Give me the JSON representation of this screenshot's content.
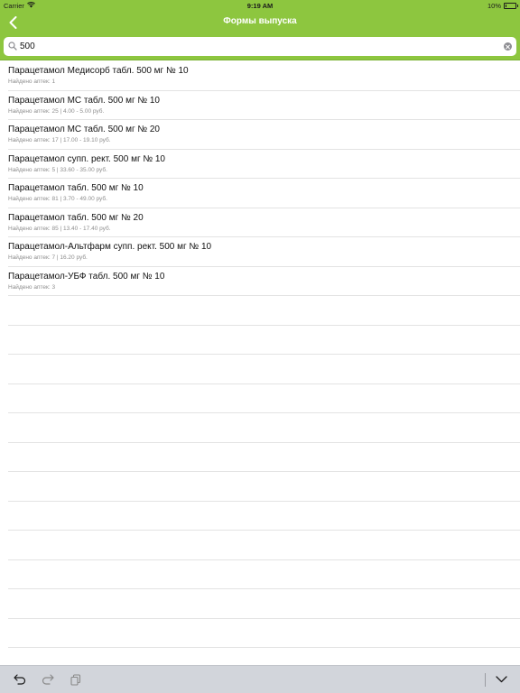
{
  "status_bar": {
    "carrier": "Carrier",
    "time": "9:19 AM",
    "battery_label": "10%",
    "battery_level": 0.1
  },
  "nav": {
    "title": "Формы выпуска",
    "back_icon": "chevron-left-icon"
  },
  "search": {
    "value": "500",
    "icon": "search-icon",
    "clear_icon": "clear-icon"
  },
  "results": [
    {
      "name": "Парацетамол Медисорб табл. 500 мг № 10",
      "info": "Найдено аптек: 1"
    },
    {
      "name": "Парацетамол МС табл. 500 мг № 10",
      "info": "Найдено аптек: 25 | 4.00 - 5.00 руб."
    },
    {
      "name": "Парацетамол МС табл. 500 мг № 20",
      "info": "Найдено аптек: 17 | 17.00 - 19.10 руб."
    },
    {
      "name": "Парацетамол супп. рект. 500 мг № 10",
      "info": "Найдено аптек: 5 | 33.60 - 35.00 руб."
    },
    {
      "name": "Парацетамол табл. 500 мг № 10",
      "info": "Найдено аптек: 81 | 3.70 - 49.00 руб."
    },
    {
      "name": "Парацетамол табл. 500 мг № 20",
      "info": "Найдено аптек: 85 | 13.40 - 17.40 руб."
    },
    {
      "name": "Парацетамол-Альтфарм супп. рект. 500 мг № 10",
      "info": "Найдено аптек: 7 | 16.20 руб."
    },
    {
      "name": "Парацетамол-УБФ табл. 500 мг № 10",
      "info": "Найдено аптек: 3"
    }
  ],
  "keyboard_bar": {
    "undo_icon": "undo-icon",
    "redo_icon": "redo-icon",
    "paste_icon": "paste-icon",
    "dismiss_icon": "chevron-down-icon"
  },
  "colors": {
    "accent": "#8dc63f",
    "keyboard_bar": "#d2d5db"
  }
}
